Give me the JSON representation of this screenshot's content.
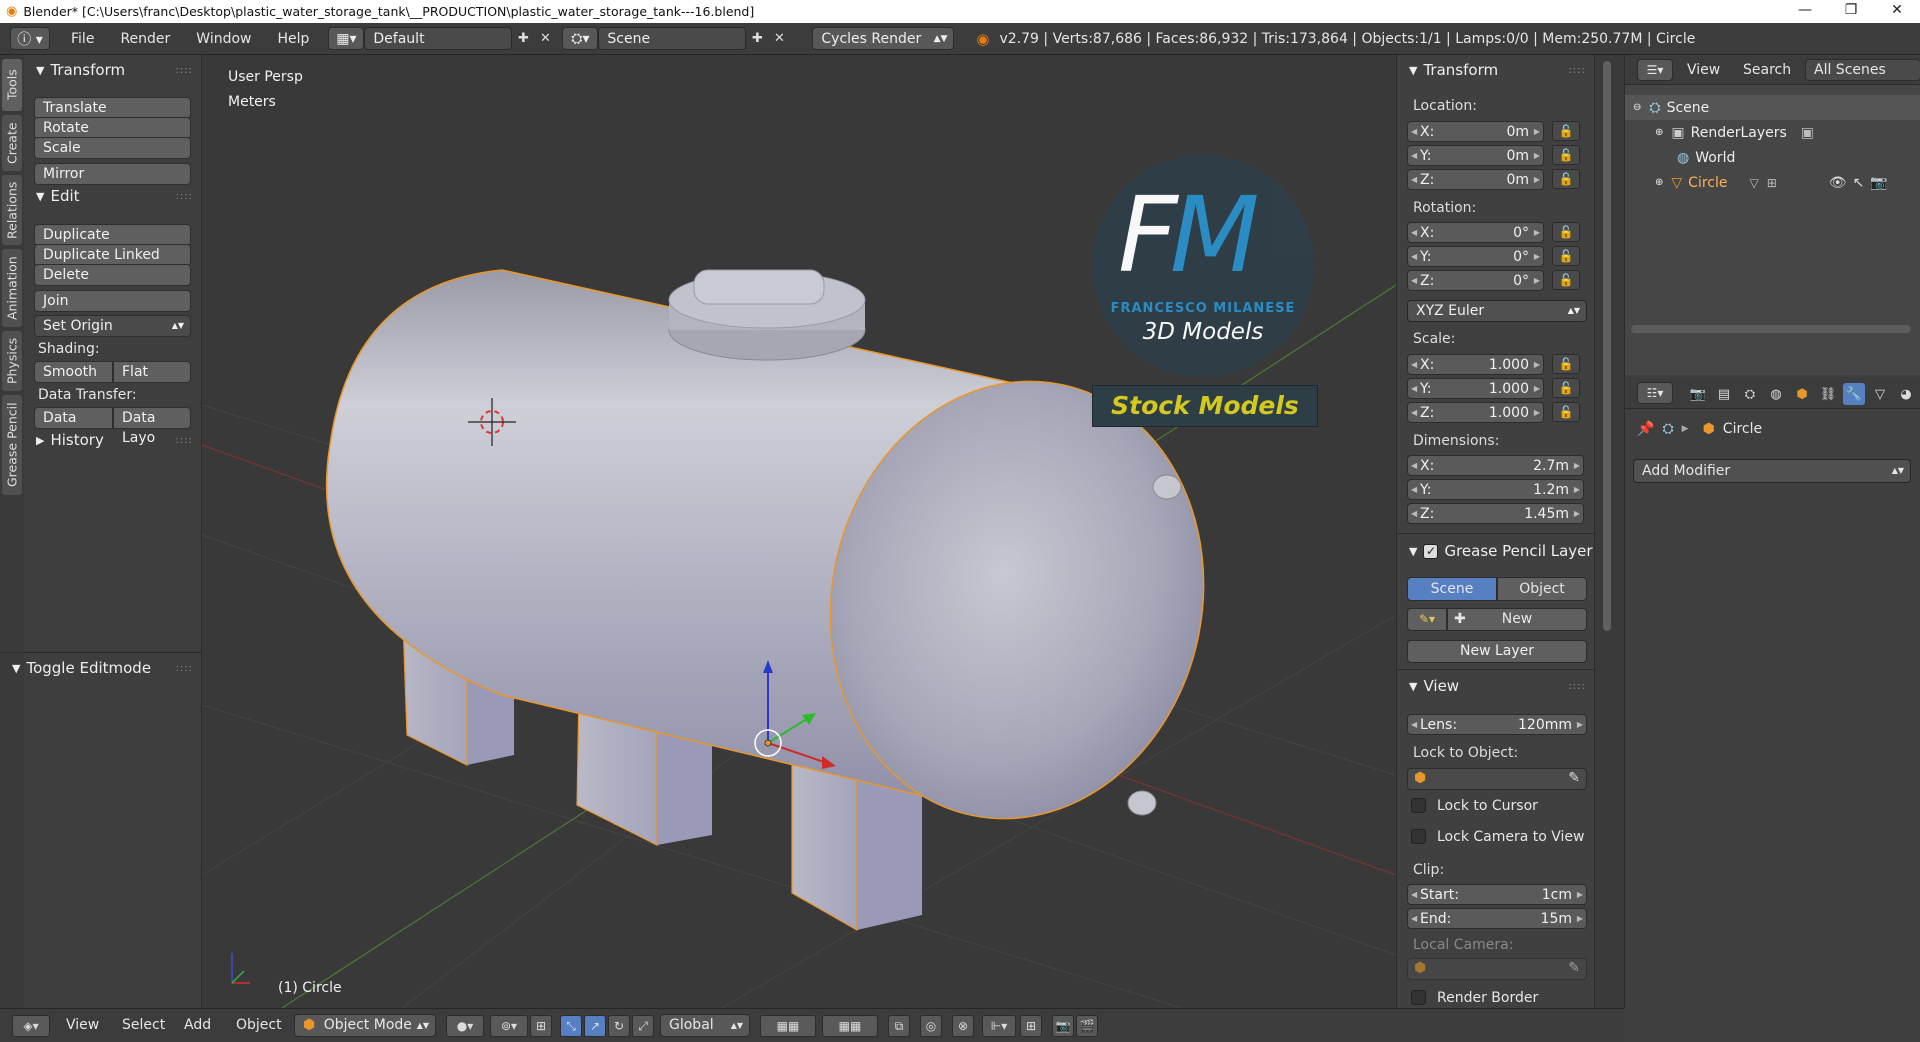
{
  "window": {
    "title": "Blender* [C:\\Users\\franc\\Desktop\\plastic_water_storage_tank\\__PRODUCTION\\plastic_water_storage_tank---16.blend]",
    "controls": [
      "—",
      "❐",
      "✕"
    ]
  },
  "header": {
    "menus": [
      "File",
      "Render",
      "Window",
      "Help"
    ],
    "screen_layout": "Default",
    "scene": "Scene",
    "render_engine": "Cycles Render",
    "stats": "v2.79 | Verts:87,686 | Faces:86,932 | Tris:173,864 | Objects:1/1 | Lamps:0/0 | Mem:250.77M | Circle"
  },
  "tool_tabs": [
    "Tools",
    "Create",
    "Relations",
    "Animation",
    "Physics",
    "Grease Pencil"
  ],
  "toolshelf": {
    "transform_title": "Transform",
    "transform_buttons": [
      "Translate",
      "Rotate",
      "Scale"
    ],
    "mirror": "Mirror",
    "edit_title": "Edit",
    "edit_buttons": [
      "Duplicate",
      "Duplicate Linked",
      "Delete"
    ],
    "join": "Join",
    "set_origin": "Set Origin",
    "shading_label": "Shading:",
    "smooth": "Smooth",
    "flat": "Flat",
    "data_transfer_label": "Data Transfer:",
    "data": "Data",
    "data_layout": "Data Layo",
    "history_title": "History",
    "operator_title": "Toggle Editmode"
  },
  "viewport": {
    "view_name": "User Persp",
    "units": "Meters",
    "object_label": "(1) Circle",
    "watermark": {
      "monogram": "FM",
      "name": "FRANCESCO MILANESE",
      "subtitle": "3D Models",
      "banner": "Stock Models"
    },
    "colors": {
      "background": "#393939",
      "selection_outline": "#e8972a",
      "watermark_blue": "#2a8fc8",
      "banner_text": "#d4c91e"
    }
  },
  "npanel": {
    "transform_title": "Transform",
    "location_label": "Location:",
    "location": [
      {
        "axis": "X:",
        "value": "0m"
      },
      {
        "axis": "Y:",
        "value": "0m"
      },
      {
        "axis": "Z:",
        "value": "0m"
      }
    ],
    "rotation_label": "Rotation:",
    "rotation": [
      {
        "axis": "X:",
        "value": "0°"
      },
      {
        "axis": "Y:",
        "value": "0°"
      },
      {
        "axis": "Z:",
        "value": "0°"
      }
    ],
    "rotation_mode": "XYZ Euler",
    "scale_label": "Scale:",
    "scale": [
      {
        "axis": "X:",
        "value": "1.000"
      },
      {
        "axis": "Y:",
        "value": "1.000"
      },
      {
        "axis": "Z:",
        "value": "1.000"
      }
    ],
    "dimensions_label": "Dimensions:",
    "dimensions": [
      {
        "axis": "X:",
        "value": "2.7m"
      },
      {
        "axis": "Y:",
        "value": "1.2m"
      },
      {
        "axis": "Z:",
        "value": "1.45m"
      }
    ],
    "grease_title": "Grease Pencil Layer",
    "grease_scene": "Scene",
    "grease_object": "Object",
    "grease_new": "New",
    "grease_new_layer": "New Layer",
    "view_title": "View",
    "lens_label": "Lens:",
    "lens_value": "120mm",
    "lock_object_label": "Lock to Object:",
    "lock_cursor": "Lock to Cursor",
    "lock_camera": "Lock Camera to View",
    "clip_label": "Clip:",
    "clip_start_label": "Start:",
    "clip_start": "1cm",
    "clip_end_label": "End:",
    "clip_end": "15m",
    "local_camera_label": "Local Camera:",
    "render_border": "Render Border"
  },
  "outliner": {
    "menus": [
      "View",
      "Search"
    ],
    "filter": "All Scenes",
    "items": [
      "Scene",
      "RenderLayers",
      "World",
      "Circle"
    ]
  },
  "properties": {
    "context_object": "Circle",
    "add_modifier": "Add Modifier"
  },
  "bottombar": {
    "menus": [
      "View",
      "Select",
      "Add",
      "Object"
    ],
    "mode": "Object Mode",
    "orientation": "Global"
  }
}
